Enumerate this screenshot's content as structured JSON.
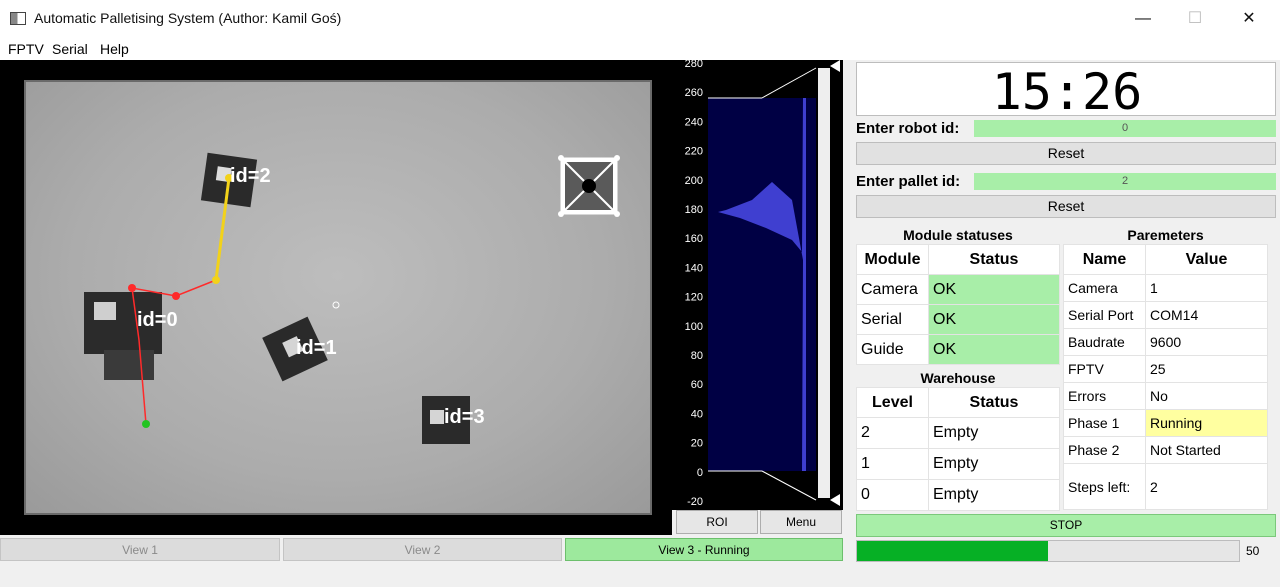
{
  "window": {
    "title": "Automatic Palletising System (Author: Kamil Goś)",
    "minimize": "—",
    "maximize": "☐",
    "close": "✕"
  },
  "menu": [
    "FPTV",
    "Serial",
    "Help"
  ],
  "camera": {
    "markers": [
      {
        "label": "id=2"
      },
      {
        "label": "id=0"
      },
      {
        "label": "id=1"
      },
      {
        "label": "id=3"
      }
    ]
  },
  "histogram": {
    "y_ticks": [
      "280",
      "260",
      "240",
      "220",
      "200",
      "180",
      "160",
      "140",
      "120",
      "100",
      "80",
      "60",
      "40",
      "20",
      "0",
      "-20"
    ],
    "roi_button": "ROI",
    "menu_button": "Menu",
    "colors": {
      "background": "#000044",
      "fill": "#3f3fd0"
    }
  },
  "view_tabs": [
    {
      "label": "View 1",
      "state": "disabled"
    },
    {
      "label": "View 2",
      "state": "disabled"
    },
    {
      "label": "View 3 - Running",
      "state": "active"
    }
  ],
  "clock": "15:26",
  "robot": {
    "label": "Enter robot id:",
    "value": "0",
    "reset": "Reset"
  },
  "pallet": {
    "label": "Enter pallet id:",
    "value": "2",
    "reset": "Reset"
  },
  "modules": {
    "title": "Module statuses",
    "headers": [
      "Module",
      "Status"
    ],
    "rows": [
      {
        "name": "Camera",
        "status": "OK"
      },
      {
        "name": "Serial",
        "status": "OK"
      },
      {
        "name": "Guide",
        "status": "OK"
      }
    ]
  },
  "warehouse": {
    "title": "Warehouse",
    "headers": [
      "Level",
      "Status"
    ],
    "rows": [
      {
        "level": "2",
        "status": "Empty"
      },
      {
        "level": "1",
        "status": "Empty"
      },
      {
        "level": "0",
        "status": "Empty"
      }
    ]
  },
  "parameters": {
    "title": "Paremeters",
    "headers": [
      "Name",
      "Value"
    ],
    "rows": [
      {
        "name": "Camera",
        "value": "1"
      },
      {
        "name": "Serial Port",
        "value": "COM14"
      },
      {
        "name": "Baudrate",
        "value": "9600"
      },
      {
        "name": "FPTV",
        "value": "25"
      },
      {
        "name": "Errors",
        "value": "No"
      },
      {
        "name": "Phase 1",
        "value": "Running"
      },
      {
        "name": "Phase 2",
        "value": "Not Started"
      },
      {
        "name": "Steps left:",
        "value": "2"
      }
    ]
  },
  "stop_button": "STOP",
  "progress": {
    "value_percent": 50,
    "text": "50"
  },
  "colors": {
    "ok": "#a8eea8",
    "running": "#ffffa0",
    "progress": "#06b025"
  }
}
